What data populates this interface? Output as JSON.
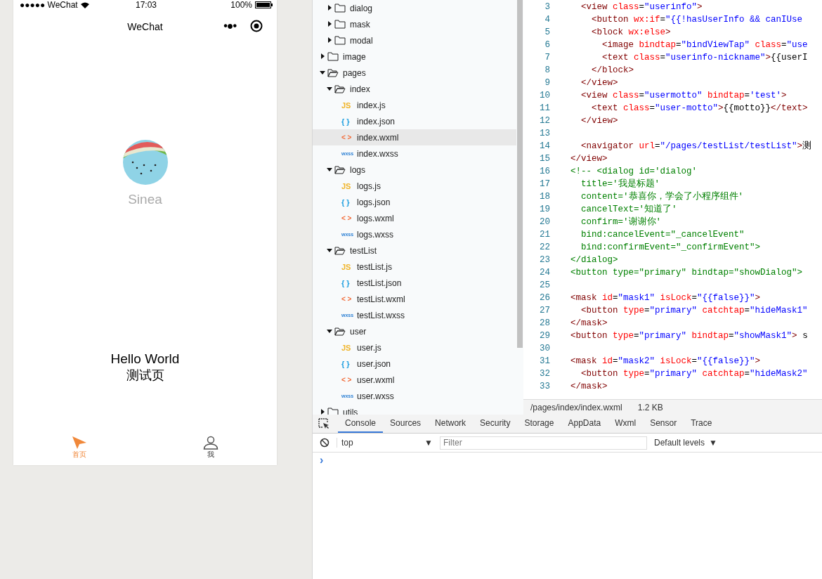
{
  "phone": {
    "status_bar": {
      "carrier": "●●●●● WeChat",
      "time": "17:03",
      "battery": "100%"
    },
    "nav": {
      "title": "WeChat",
      "menu": "•●•"
    },
    "user_name": "Sinea",
    "motto": "Hello World",
    "link": "测试页",
    "tab_bar": [
      {
        "label": "首页",
        "kind": "home",
        "selected": true
      },
      {
        "label": "我",
        "kind": "user",
        "selected": false
      }
    ]
  },
  "file_tree": [
    {
      "children": [
        {
          "kind": "folder",
          "name": "dialog",
          "expanded": false
        },
        {
          "kind": "folder",
          "name": "mask",
          "expanded": false
        },
        {
          "kind": "folder",
          "name": "modal",
          "expanded": false
        }
      ]
    },
    {
      "kind": "folder",
      "name": "image",
      "expanded": false
    },
    {
      "kind": "folder",
      "name": "pages",
      "expanded": true,
      "children": [
        {
          "kind": "folder",
          "name": "index",
          "expanded": true,
          "children": [
            {
              "kind": "js",
              "icon": "JS",
              "name": "index.js",
              "selected": false
            },
            {
              "kind": "json",
              "icon": "{ }",
              "name": "index.json",
              "selected": false
            },
            {
              "kind": "wxml",
              "icon": "< >",
              "name": "index.wxml",
              "selected": true
            },
            {
              "kind": "wxss",
              "icon": "wxss",
              "name": "index.wxss",
              "selected": false
            }
          ]
        },
        {
          "kind": "folder",
          "name": "logs",
          "expanded": true,
          "children": [
            {
              "kind": "js",
              "icon": "JS",
              "name": "logs.js",
              "selected": false
            },
            {
              "kind": "json",
              "icon": "{ }",
              "name": "logs.json",
              "selected": false
            },
            {
              "kind": "wxml",
              "icon": "< >",
              "name": "logs.wxml",
              "selected": false
            },
            {
              "kind": "wxss",
              "icon": "wxss",
              "name": "logs.wxss",
              "selected": false
            }
          ]
        },
        {
          "kind": "folder",
          "name": "testList",
          "expanded": true,
          "children": [
            {
              "kind": "js",
              "icon": "JS",
              "name": "testList.js",
              "selected": false
            },
            {
              "kind": "json",
              "icon": "{ }",
              "name": "testList.json",
              "selected": false
            },
            {
              "kind": "wxml",
              "icon": "< >",
              "name": "testList.wxml",
              "selected": false
            },
            {
              "kind": "wxss",
              "icon": "wxss",
              "name": "testList.wxss",
              "selected": false
            }
          ]
        },
        {
          "kind": "folder",
          "name": "user",
          "expanded": true,
          "children": [
            {
              "kind": "js",
              "icon": "JS",
              "name": "user.js",
              "selected": false
            },
            {
              "kind": "json",
              "icon": "{ }",
              "name": "user.json",
              "selected": false
            },
            {
              "kind": "wxml",
              "icon": "< >",
              "name": "user.wxml",
              "selected": false
            },
            {
              "kind": "wxss",
              "icon": "wxss",
              "name": "user.wxss",
              "selected": false
            }
          ]
        }
      ]
    },
    {
      "kind": "folder",
      "name": "utils",
      "expanded": false
    }
  ],
  "editor": {
    "lines": [
      {
        "number": "3",
        "tokens": [
          {
            "kind": "tag",
            "text": "  <view"
          },
          {
            "kind": "attr",
            "text": " class"
          },
          {
            "kind": "punct",
            "text": "="
          },
          {
            "kind": "value",
            "text": "\"userinfo\""
          },
          {
            "kind": "tag",
            "text": ">"
          }
        ]
      },
      {
        "number": "4",
        "tokens": [
          {
            "kind": "tag",
            "text": "    <button"
          },
          {
            "kind": "attr",
            "text": " wx:if"
          },
          {
            "kind": "punct",
            "text": "="
          },
          {
            "kind": "value",
            "text": "\"{{!hasUserInfo && canIUse"
          }
        ]
      },
      {
        "number": "5",
        "tokens": [
          {
            "kind": "tag",
            "text": "    <block"
          },
          {
            "kind": "attr",
            "text": " wx:else"
          },
          {
            "kind": "tag",
            "text": ">"
          }
        ]
      },
      {
        "number": "6",
        "tokens": [
          {
            "kind": "tag",
            "text": "      <image"
          },
          {
            "kind": "attr",
            "text": " bindtap"
          },
          {
            "kind": "punct",
            "text": "="
          },
          {
            "kind": "value",
            "text": "\"bindViewTap\""
          },
          {
            "kind": "attr",
            "text": " class"
          },
          {
            "kind": "punct",
            "text": "="
          },
          {
            "kind": "value",
            "text": "\"use"
          }
        ]
      },
      {
        "number": "7",
        "tokens": [
          {
            "kind": "tag",
            "text": "      <text"
          },
          {
            "kind": "attr",
            "text": " class"
          },
          {
            "kind": "punct",
            "text": "="
          },
          {
            "kind": "value",
            "text": "\"userinfo-nickname\""
          },
          {
            "kind": "tag",
            "text": ">"
          },
          {
            "kind": "text",
            "text": "{{userI"
          }
        ]
      },
      {
        "number": "8",
        "tokens": [
          {
            "kind": "tag",
            "text": "    </block>"
          }
        ]
      },
      {
        "number": "9",
        "tokens": [
          {
            "kind": "tag",
            "text": "  </view>"
          }
        ]
      },
      {
        "number": "10",
        "tokens": [
          {
            "kind": "tag",
            "text": "  <view"
          },
          {
            "kind": "attr",
            "text": " class"
          },
          {
            "kind": "punct",
            "text": "="
          },
          {
            "kind": "value",
            "text": "\"usermotto\""
          },
          {
            "kind": "attr",
            "text": " bindtap"
          },
          {
            "kind": "punct",
            "text": "="
          },
          {
            "kind": "value",
            "text": "'test'"
          },
          {
            "kind": "tag",
            "text": ">"
          }
        ]
      },
      {
        "number": "11",
        "tokens": [
          {
            "kind": "tag",
            "text": "    <text"
          },
          {
            "kind": "attr",
            "text": " class"
          },
          {
            "kind": "punct",
            "text": "="
          },
          {
            "kind": "value",
            "text": "\"user-motto\""
          },
          {
            "kind": "tag",
            "text": ">"
          },
          {
            "kind": "text",
            "text": "{{motto}}"
          },
          {
            "kind": "tag",
            "text": "</text>"
          }
        ]
      },
      {
        "number": "12",
        "tokens": [
          {
            "kind": "tag",
            "text": "  </view>"
          }
        ]
      },
      {
        "number": "13"
      },
      {
        "number": "14",
        "tokens": [
          {
            "kind": "tag",
            "text": "  <navigator"
          },
          {
            "kind": "attr",
            "text": " url"
          },
          {
            "kind": "punct",
            "text": "="
          },
          {
            "kind": "value",
            "text": "\"/pages/testList/testList\""
          },
          {
            "kind": "tag",
            "text": ">"
          },
          {
            "kind": "text",
            "text": "测"
          }
        ]
      },
      {
        "number": "15",
        "tokens": [
          {
            "kind": "tag",
            "text": "</view>"
          }
        ]
      },
      {
        "number": "16",
        "tokens": [
          {
            "kind": "comment",
            "text": "<!-- <dialog id='dialog'"
          }
        ]
      },
      {
        "number": "17",
        "tokens": [
          {
            "kind": "comment",
            "text": "  title='我是标题'"
          }
        ]
      },
      {
        "number": "18",
        "tokens": [
          {
            "kind": "comment",
            "text": "  content='恭喜你，学会了小程序组件'"
          }
        ]
      },
      {
        "number": "19",
        "tokens": [
          {
            "kind": "comment",
            "text": "  cancelText='知道了'"
          }
        ]
      },
      {
        "number": "20",
        "tokens": [
          {
            "kind": "comment",
            "text": "  confirm='谢谢你'"
          }
        ]
      },
      {
        "number": "21",
        "tokens": [
          {
            "kind": "comment",
            "text": "  bind:cancelEvent=\"_cancelEvent\""
          }
        ]
      },
      {
        "number": "22",
        "tokens": [
          {
            "kind": "comment",
            "text": "  bind:confirmEvent=\"_confirmEvent\">"
          }
        ]
      },
      {
        "number": "23",
        "tokens": [
          {
            "kind": "comment",
            "text": "</dialog>"
          }
        ]
      },
      {
        "number": "24",
        "tokens": [
          {
            "kind": "comment",
            "text": "<button type=\"primary\" bindtap=\"showDialog\">"
          }
        ]
      },
      {
        "number": "25"
      },
      {
        "number": "26",
        "tokens": [
          {
            "kind": "tag",
            "text": "<mask"
          },
          {
            "kind": "attr",
            "text": " id"
          },
          {
            "kind": "punct",
            "text": "="
          },
          {
            "kind": "value",
            "text": "\"mask1\""
          },
          {
            "kind": "attr",
            "text": " isLock"
          },
          {
            "kind": "punct",
            "text": "="
          },
          {
            "kind": "value",
            "text": "\"{{false}}\""
          },
          {
            "kind": "tag",
            "text": ">"
          }
        ]
      },
      {
        "number": "27",
        "tokens": [
          {
            "kind": "tag",
            "text": "  <button"
          },
          {
            "kind": "attr",
            "text": " type"
          },
          {
            "kind": "punct",
            "text": "="
          },
          {
            "kind": "value",
            "text": "\"primary\""
          },
          {
            "kind": "attr",
            "text": " catchtap"
          },
          {
            "kind": "punct",
            "text": "="
          },
          {
            "kind": "value",
            "text": "\"hideMask1\""
          }
        ]
      },
      {
        "number": "28",
        "tokens": [
          {
            "kind": "tag",
            "text": "</mask>"
          }
        ]
      },
      {
        "number": "29",
        "tokens": [
          {
            "kind": "tag",
            "text": "<button"
          },
          {
            "kind": "attr",
            "text": " type"
          },
          {
            "kind": "punct",
            "text": "="
          },
          {
            "kind": "value",
            "text": "\"primary\""
          },
          {
            "kind": "attr",
            "text": " bindtap"
          },
          {
            "kind": "punct",
            "text": "="
          },
          {
            "kind": "value",
            "text": "\"showMask1\""
          },
          {
            "kind": "tag",
            "text": ">"
          },
          {
            "kind": "text",
            "text": " s"
          }
        ]
      },
      {
        "number": "30"
      },
      {
        "number": "31",
        "tokens": [
          {
            "kind": "tag",
            "text": "<mask"
          },
          {
            "kind": "attr",
            "text": " id"
          },
          {
            "kind": "punct",
            "text": "="
          },
          {
            "kind": "value",
            "text": "\"mask2\""
          },
          {
            "kind": "attr",
            "text": " isLock"
          },
          {
            "kind": "punct",
            "text": "="
          },
          {
            "kind": "value",
            "text": "\"{{false}}\""
          },
          {
            "kind": "tag",
            "text": ">"
          }
        ]
      },
      {
        "number": "32",
        "tokens": [
          {
            "kind": "tag",
            "text": "  <button"
          },
          {
            "kind": "attr",
            "text": " type"
          },
          {
            "kind": "punct",
            "text": "="
          },
          {
            "kind": "value",
            "text": "\"primary\""
          },
          {
            "kind": "attr",
            "text": " catchtap"
          },
          {
            "kind": "punct",
            "text": "="
          },
          {
            "kind": "value",
            "text": "\"hideMask2\""
          }
        ]
      },
      {
        "number": "33",
        "tokens": [
          {
            "kind": "tag",
            "text": "</mask>"
          }
        ]
      }
    ],
    "status_bar": {
      "path": "/pages/index/index.wxml",
      "size": "1.2 KB"
    }
  },
  "devtools": {
    "tabs": [
      {
        "label": "Console",
        "selected": true
      },
      {
        "label": "Sources",
        "selected": false
      },
      {
        "label": "Network",
        "selected": false
      },
      {
        "label": "Security",
        "selected": false
      },
      {
        "label": "Storage",
        "selected": false
      },
      {
        "label": "AppData",
        "selected": false
      },
      {
        "label": "Wxml",
        "selected": false
      },
      {
        "label": "Sensor",
        "selected": false
      },
      {
        "label": "Trace",
        "selected": false
      }
    ],
    "context": "top",
    "caret": "▼",
    "filter": {
      "placeholder": "Filter"
    },
    "levels": "Default levels",
    "levels_caret": "▼",
    "prompt": "›"
  }
}
